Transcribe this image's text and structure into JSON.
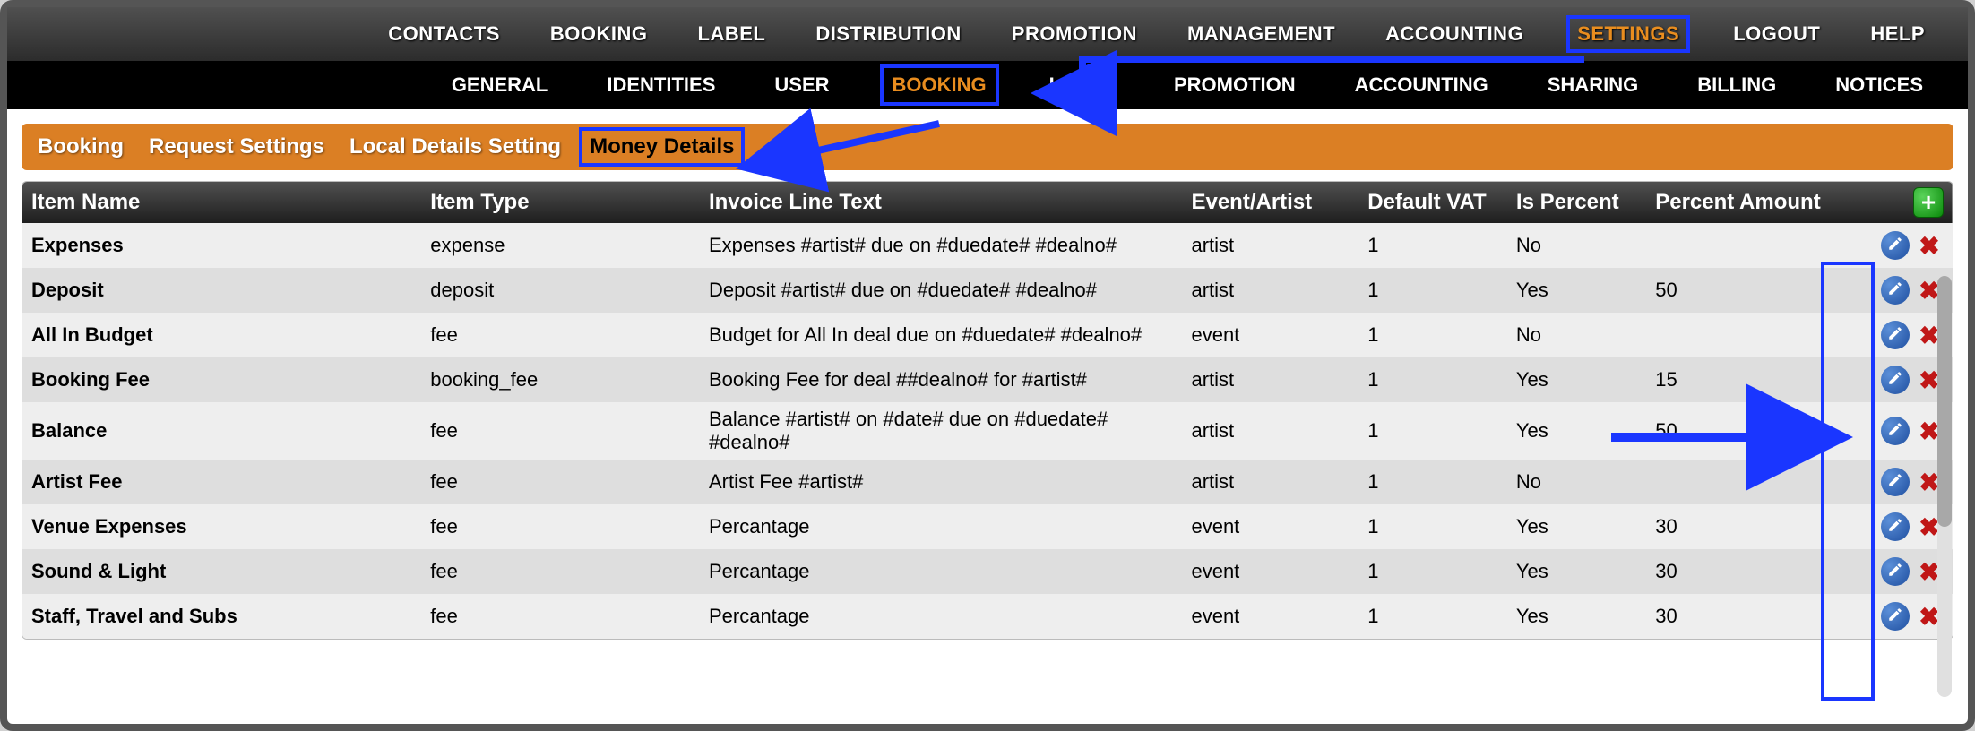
{
  "topnav": {
    "items": [
      {
        "label": "CONTACTS"
      },
      {
        "label": "BOOKING"
      },
      {
        "label": "LABEL"
      },
      {
        "label": "DISTRIBUTION"
      },
      {
        "label": "PROMOTION"
      },
      {
        "label": "MANAGEMENT"
      },
      {
        "label": "ACCOUNTING"
      },
      {
        "label": "SETTINGS",
        "active": true
      },
      {
        "label": "LOGOUT"
      },
      {
        "label": "HELP"
      }
    ]
  },
  "subnav": {
    "items": [
      {
        "label": "GENERAL"
      },
      {
        "label": "IDENTITIES"
      },
      {
        "label": "USER"
      },
      {
        "label": "BOOKING",
        "active": true
      },
      {
        "label": "LABEL"
      },
      {
        "label": "PROMOTION"
      },
      {
        "label": "ACCOUNTING"
      },
      {
        "label": "SHARING"
      },
      {
        "label": "BILLING"
      },
      {
        "label": "NOTICES"
      }
    ]
  },
  "tabs": {
    "items": [
      {
        "label": "Booking"
      },
      {
        "label": "Request Settings"
      },
      {
        "label": "Local Details Setting"
      },
      {
        "label": "Money Details",
        "active": true
      }
    ]
  },
  "table": {
    "headers": {
      "name": "Item Name",
      "type": "Item Type",
      "invoice": "Invoice Line Text",
      "eventartist": "Event/Artist",
      "vat": "Default VAT",
      "ispercent": "Is Percent",
      "percamt": "Percent Amount"
    },
    "rows": [
      {
        "name": "Expenses",
        "type": "expense",
        "invoice": "Expenses #artist# due on #duedate# #dealno#",
        "eventartist": "artist",
        "vat": "1",
        "ispercent": "No",
        "percamt": ""
      },
      {
        "name": "Deposit",
        "type": "deposit",
        "invoice": "Deposit #artist# due on #duedate# #dealno#",
        "eventartist": "artist",
        "vat": "1",
        "ispercent": "Yes",
        "percamt": "50"
      },
      {
        "name": "All In Budget",
        "type": "fee",
        "invoice": "Budget for All In deal due on #duedate# #dealno#",
        "eventartist": "event",
        "vat": "1",
        "ispercent": "No",
        "percamt": ""
      },
      {
        "name": "Booking Fee",
        "type": "booking_fee",
        "invoice": "Booking Fee for deal ##dealno# for #artist#",
        "eventartist": "artist",
        "vat": "1",
        "ispercent": "Yes",
        "percamt": "15"
      },
      {
        "name": "Balance",
        "type": "fee",
        "invoice": "Balance #artist# on #date# due on #duedate# #dealno#",
        "eventartist": "artist",
        "vat": "1",
        "ispercent": "Yes",
        "percamt": "50"
      },
      {
        "name": "Artist Fee",
        "type": "fee",
        "invoice": "Artist Fee #artist#",
        "eventartist": "artist",
        "vat": "1",
        "ispercent": "No",
        "percamt": ""
      },
      {
        "name": "Venue Expenses",
        "type": "fee",
        "invoice": "Percantage",
        "eventartist": "event",
        "vat": "1",
        "ispercent": "Yes",
        "percamt": "30"
      },
      {
        "name": "Sound & Light",
        "type": "fee",
        "invoice": "Percantage",
        "eventartist": "event",
        "vat": "1",
        "ispercent": "Yes",
        "percamt": "30"
      },
      {
        "name": "Staff, Travel and Subs",
        "type": "fee",
        "invoice": "Percantage",
        "eventartist": "event",
        "vat": "1",
        "ispercent": "Yes",
        "percamt": "30"
      }
    ]
  },
  "icons": {
    "add": "+",
    "delete": "✖"
  }
}
